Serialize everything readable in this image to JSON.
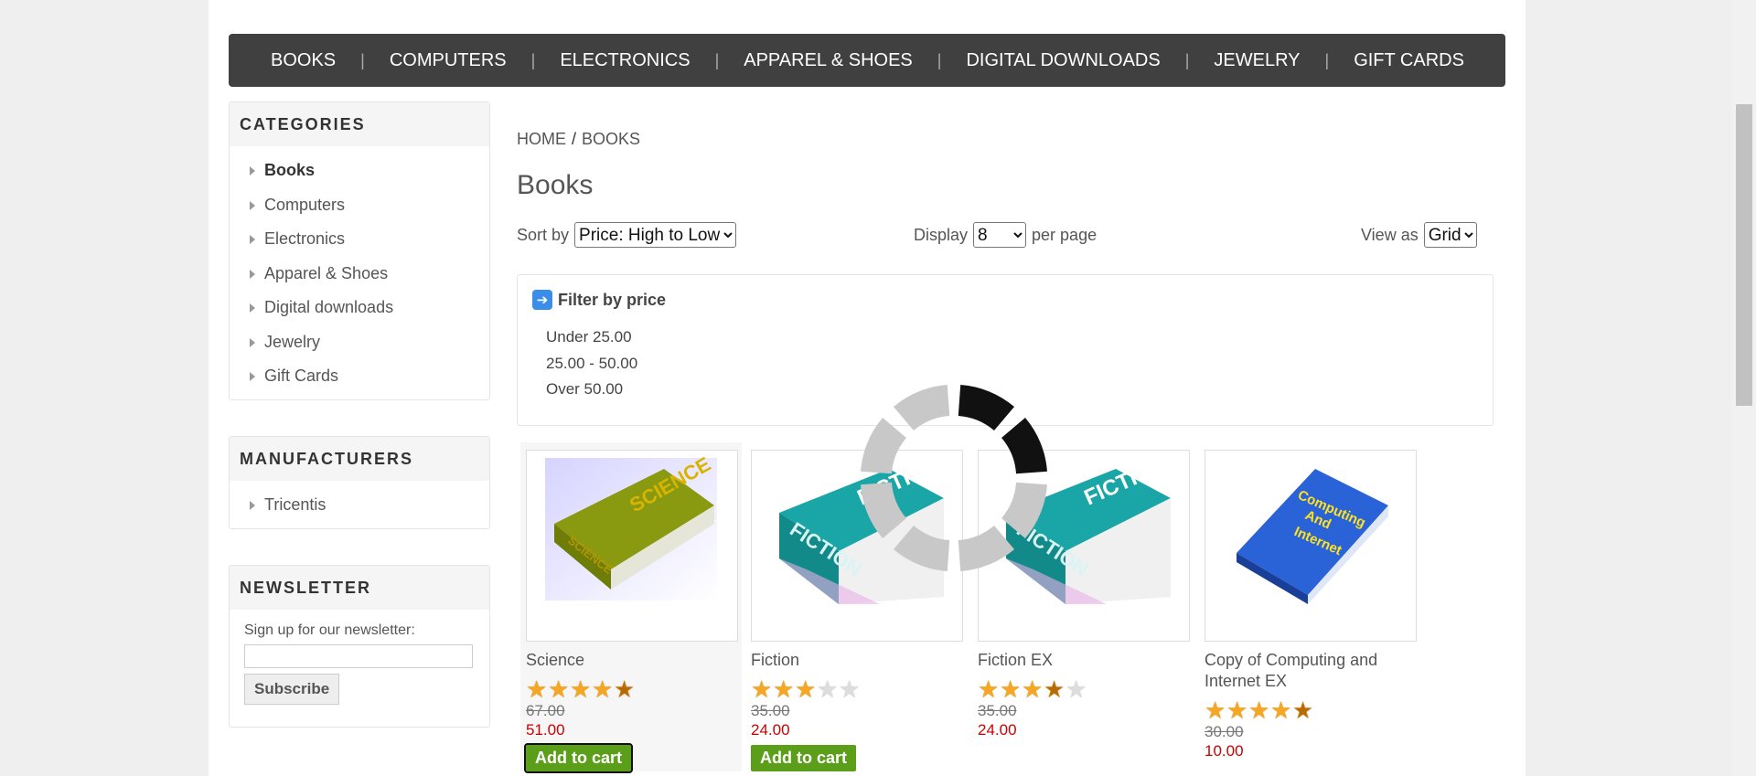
{
  "top_menu": [
    {
      "label": "BOOKS"
    },
    {
      "label": "COMPUTERS"
    },
    {
      "label": "ELECTRONICS"
    },
    {
      "label": "APPAREL & SHOES"
    },
    {
      "label": "DIGITAL DOWNLOADS"
    },
    {
      "label": "JEWELRY"
    },
    {
      "label": "GIFT CARDS"
    }
  ],
  "categories": {
    "title": "CATEGORIES",
    "items": [
      {
        "label": "Books"
      },
      {
        "label": "Computers"
      },
      {
        "label": "Electronics"
      },
      {
        "label": "Apparel & Shoes"
      },
      {
        "label": "Digital downloads"
      },
      {
        "label": "Jewelry"
      },
      {
        "label": "Gift Cards"
      }
    ]
  },
  "manufacturers": {
    "title": "MANUFACTURERS",
    "items": [
      {
        "label": "Tricentis"
      }
    ]
  },
  "newsletter": {
    "title": "NEWSLETTER",
    "label": "Sign up for our newsletter:",
    "email_value": "",
    "subscribe_label": "Subscribe"
  },
  "breadcrumb": {
    "home": "HOME",
    "separator": "/",
    "current": "BOOKS"
  },
  "page_title": "Books",
  "toolbar": {
    "sort_label": "Sort by",
    "sort_value": "Price: High to Low",
    "display_label": "Display",
    "display_value": "8",
    "per_page_label": "per page",
    "view_label": "View as",
    "view_value": "Grid"
  },
  "filter": {
    "title": "Filter by price",
    "ranges": [
      "Under 25.00",
      "25.00 - 50.00",
      "Over 50.00"
    ]
  },
  "products": [
    {
      "name": "Science",
      "rating": 4.5,
      "old_price": "67.00",
      "price": "51.00",
      "cart_label": "Add to cart"
    },
    {
      "name": "Fiction",
      "rating": 3,
      "old_price": "35.00",
      "price": "24.00",
      "cart_label": "Add to cart"
    },
    {
      "name": "Fiction EX",
      "rating": 3.5,
      "old_price": "35.00",
      "price": "24.00"
    },
    {
      "name": "Copy of Computing and Internet EX",
      "rating": 4.5,
      "old_price": "30.00",
      "price": "10.00"
    }
  ],
  "book_covers": {
    "science": "SCIENCE",
    "fiction": "FICTION",
    "computing": [
      "Computing",
      "And",
      "Internet"
    ]
  },
  "colors": {
    "menu_bg": "#404040",
    "add_to_cart": "#5a9e19",
    "price": "#cc0000",
    "star": "#f5a623"
  }
}
